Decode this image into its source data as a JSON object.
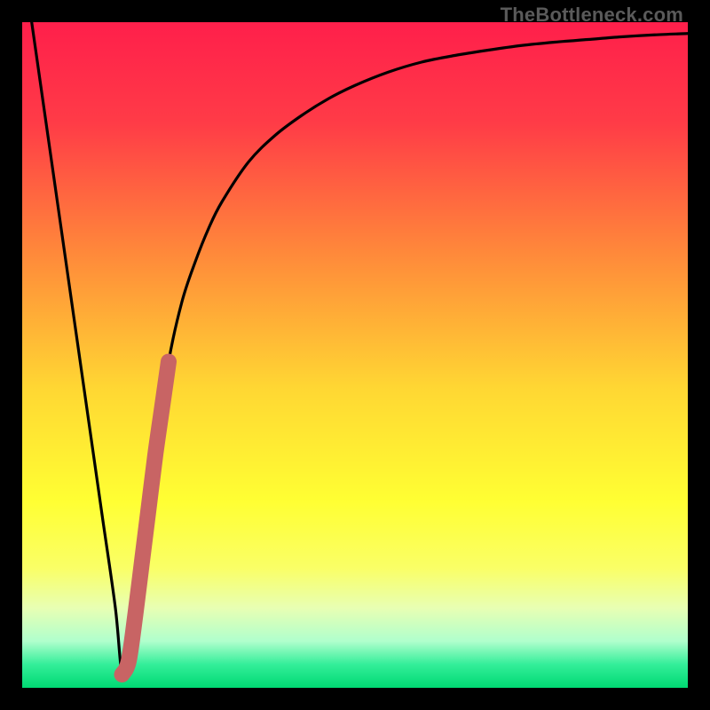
{
  "watermark": "TheBottleneck.com",
  "chart_data": {
    "type": "line",
    "title": "",
    "xlabel": "",
    "ylabel": "",
    "xlim": [
      0,
      100
    ],
    "ylim": [
      0,
      100
    ],
    "grid": false,
    "legend": false,
    "annotations": [],
    "series": [
      {
        "name": "curve",
        "color": "#000000",
        "x": [
          0,
          2,
          4,
          6,
          8,
          10,
          12,
          14,
          15,
          16,
          18,
          20,
          22,
          24,
          26,
          28,
          30,
          34,
          38,
          42,
          46,
          50,
          55,
          60,
          65,
          70,
          75,
          80,
          85,
          90,
          95,
          100
        ],
        "y": [
          110,
          96,
          82,
          68,
          54,
          40,
          26,
          12,
          2,
          4,
          18,
          35,
          49,
          58,
          64,
          69,
          73,
          79,
          83,
          86,
          88.5,
          90.5,
          92.5,
          94,
          95,
          95.8,
          96.5,
          97,
          97.4,
          97.8,
          98.1,
          98.3
        ]
      },
      {
        "name": "highlight-segment",
        "color": "#c86464",
        "x": [
          15,
          16,
          17,
          18,
          19,
          20,
          21,
          22
        ],
        "y": [
          2,
          4,
          11,
          19,
          27,
          35,
          42,
          49
        ]
      }
    ],
    "gradient_stops": [
      {
        "offset": 0.0,
        "color": "#ff1f4b"
      },
      {
        "offset": 0.15,
        "color": "#ff3b47"
      },
      {
        "offset": 0.35,
        "color": "#ff8a3a"
      },
      {
        "offset": 0.55,
        "color": "#ffd733"
      },
      {
        "offset": 0.72,
        "color": "#ffff33"
      },
      {
        "offset": 0.82,
        "color": "#faff66"
      },
      {
        "offset": 0.88,
        "color": "#e8ffb3"
      },
      {
        "offset": 0.93,
        "color": "#b0ffcd"
      },
      {
        "offset": 0.965,
        "color": "#33ee99"
      },
      {
        "offset": 1.0,
        "color": "#00d973"
      }
    ]
  }
}
